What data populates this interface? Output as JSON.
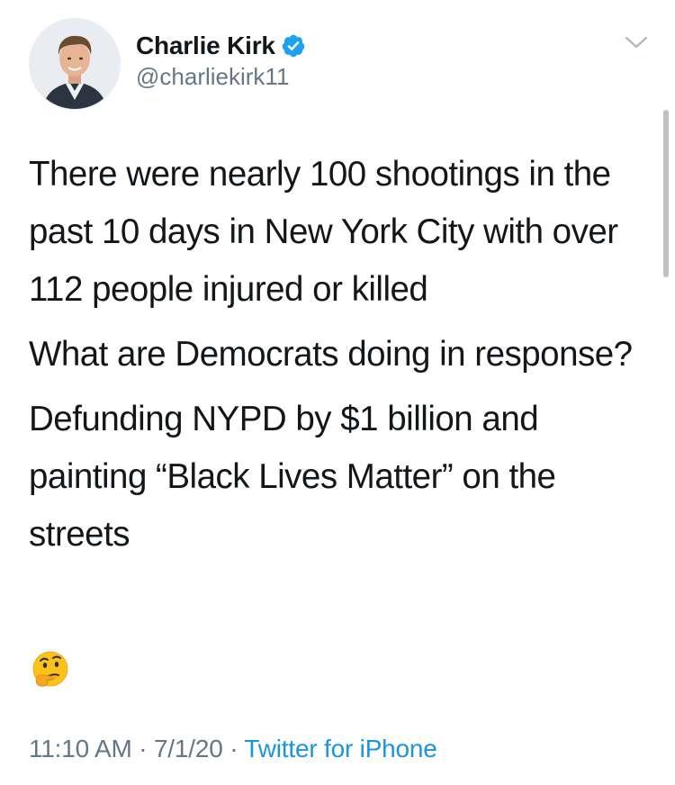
{
  "author": {
    "display_name": "Charlie Kirk",
    "handle": "@charliekirk11",
    "verified": true,
    "avatar_icon": "profile-photo"
  },
  "tweet": {
    "paragraphs": [
      "There were nearly 100 shootings in the past 10 days in New York City with over 112 people injured or killed",
      "What are Democrats doing in response?",
      "Defunding NYPD by $1 billion and painting “Black Lives Matter” on the streets"
    ],
    "emoji_name": "thinking-face-icon"
  },
  "meta": {
    "time": "11:10 AM",
    "separator": "·",
    "date": "7/1/20",
    "source": "Twitter for iPhone"
  },
  "colors": {
    "text": "#14171a",
    "secondary": "#657786",
    "accent": "#1b95e0",
    "verified_badge": "#1da1f2"
  },
  "icons": {
    "menu": "chevron-down-icon",
    "badge": "verified-badge-icon"
  }
}
